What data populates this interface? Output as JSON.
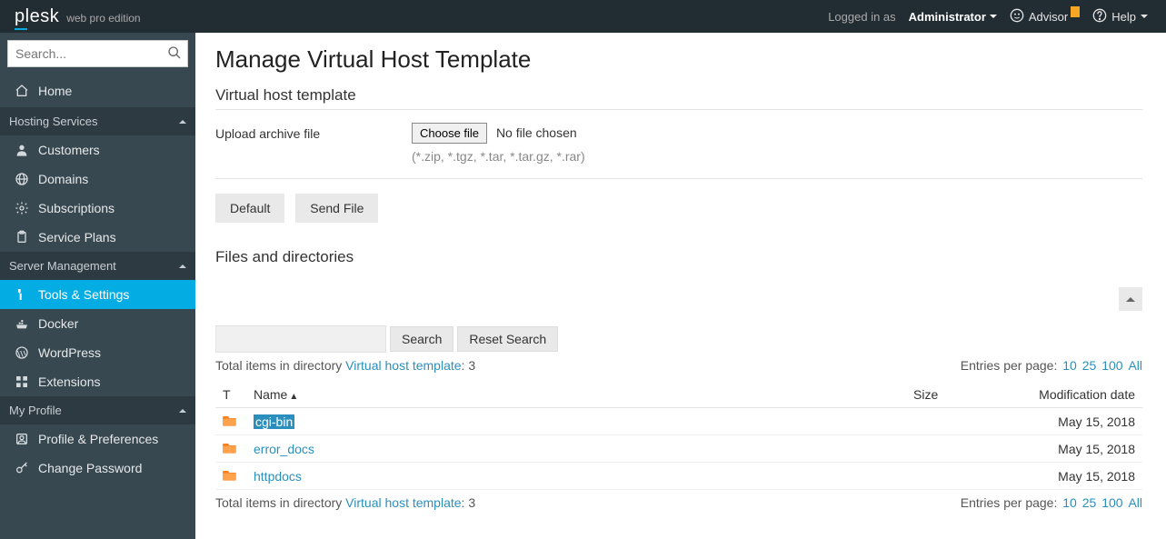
{
  "brand": {
    "name": "plesk",
    "edition": "web pro edition"
  },
  "topbar": {
    "logged_in_as_label": "Logged in as",
    "username": "Administrator",
    "advisor_label": "Advisor",
    "help_label": "Help"
  },
  "search": {
    "placeholder": "Search..."
  },
  "nav": {
    "home": "Home",
    "groups": [
      {
        "label": "Hosting Services",
        "items": [
          "Customers",
          "Domains",
          "Subscriptions",
          "Service Plans"
        ],
        "icons": [
          "user",
          "globe",
          "gear",
          "clipboard"
        ]
      },
      {
        "label": "Server Management",
        "items": [
          "Tools & Settings",
          "Docker",
          "WordPress",
          "Extensions"
        ],
        "icons": [
          "tools",
          "ship",
          "wp",
          "ext"
        ],
        "active_index": 0
      },
      {
        "label": "My Profile",
        "items": [
          "Profile & Preferences",
          "Change Password"
        ],
        "icons": [
          "profile",
          "key"
        ]
      }
    ]
  },
  "page": {
    "title": "Manage Virtual Host Template",
    "section1_title": "Virtual host template",
    "upload_label": "Upload archive file",
    "choose_file_label": "Choose file",
    "no_file_chosen": "No file chosen",
    "file_hint": "(*.zip, *.tgz, *.tar, *.tar.gz, *.rar)",
    "default_btn": "Default",
    "send_file_btn": "Send File",
    "section2_title": "Files and directories",
    "list_search_btn": "Search",
    "list_reset_btn": "Reset Search",
    "totals_prefix": "Total items in directory ",
    "totals_link": "Virtual host template",
    "totals_count": "3",
    "entries_label": "Entries per page:",
    "entries_options": [
      "10",
      "25",
      "100",
      "All"
    ],
    "columns": {
      "t": "T",
      "name": "Name",
      "size": "Size",
      "date": "Modification date"
    },
    "rows": [
      {
        "name": "cgi-bin",
        "size": "",
        "date": "May 15, 2018",
        "selected": true
      },
      {
        "name": "error_docs",
        "size": "",
        "date": "May 15, 2018",
        "selected": false
      },
      {
        "name": "httpdocs",
        "size": "",
        "date": "May 15, 2018",
        "selected": false
      }
    ]
  }
}
